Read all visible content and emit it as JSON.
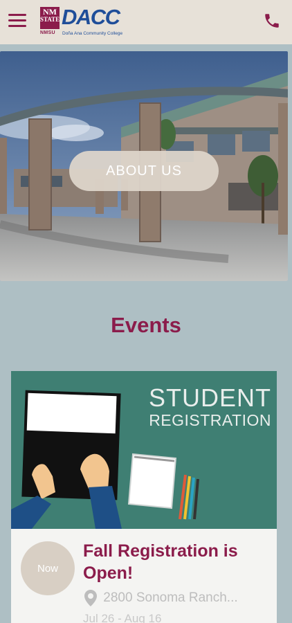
{
  "header": {
    "logo": {
      "seal_line1": "NM",
      "seal_line2": "STATE",
      "seal_bottom": "NMSU",
      "wordmark": "DACC",
      "subtitle": "Doña Ana Community College"
    },
    "menu_icon": "hamburger-menu-icon",
    "phone_icon": "phone-icon"
  },
  "hero": {
    "button_label": "ABOUT US",
    "image": "campus-building-photo"
  },
  "events": {
    "section_title": "Events",
    "items": [
      {
        "image_title_line1": "STUDENT",
        "image_title_line2": "REGISTRATION",
        "badge": "Now",
        "title": "Fall Registration is Open!",
        "location": "2800 Sonoma Ranch...",
        "dates": "Jul 26 - Aug 16"
      }
    ]
  },
  "colors": {
    "brand_maroon": "#8b1c4b",
    "brand_blue": "#1f4e99",
    "header_bg": "#e7e1d8",
    "page_bg": "#aebfc4",
    "card_image_bg": "#3f7f73"
  }
}
